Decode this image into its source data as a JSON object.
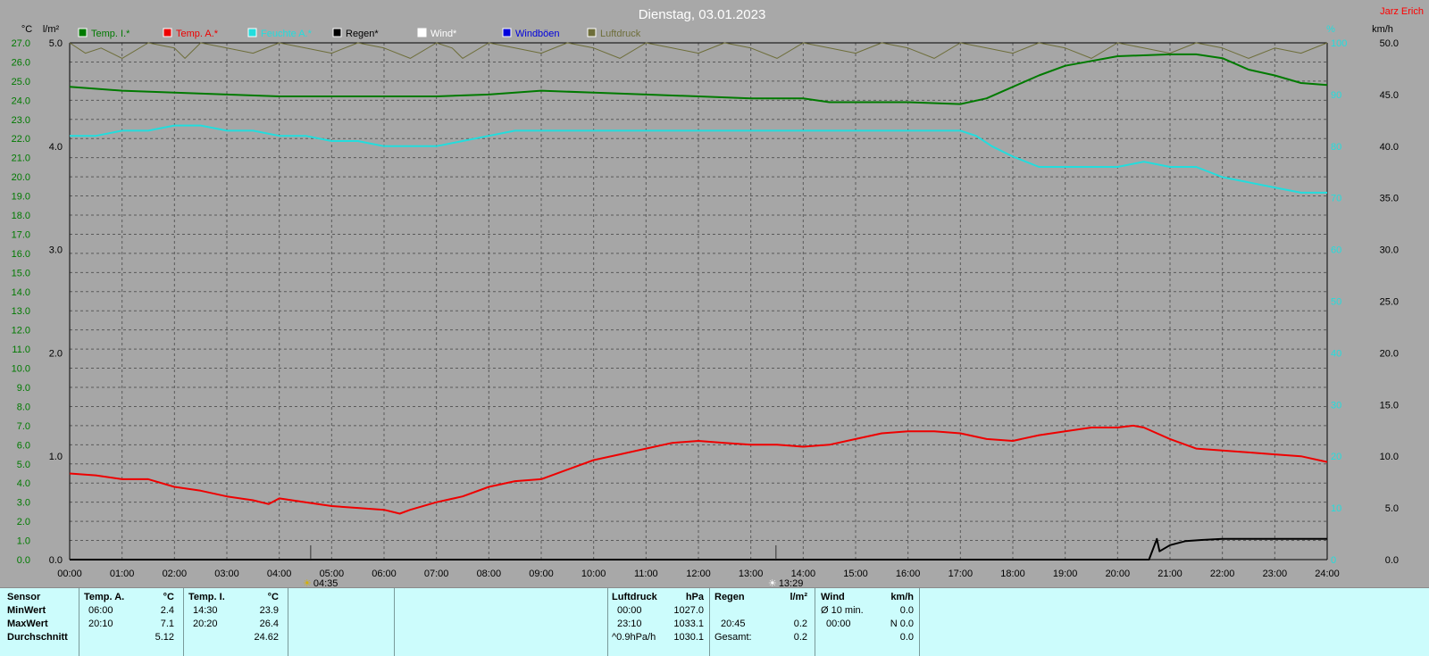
{
  "title": "Dienstag, 03.01.2023",
  "author": "Jarz Erich",
  "axis_units": {
    "temp": "°C",
    "rain": "l/m²",
    "humidity": "%",
    "wind": "km/h"
  },
  "colors": {
    "temp_in": "#007a00",
    "temp_out": "#ee0000",
    "humidity": "#22dddd",
    "rain": "#000000",
    "wind": "#ffffff",
    "gusts": "#0000dd",
    "pressure": "#6e6e3a"
  },
  "legend": [
    {
      "label": "Temp. I.*",
      "color": "#007a00"
    },
    {
      "label": "Temp. A.*",
      "color": "#ee0000"
    },
    {
      "label": "Feuchte A.*",
      "color": "#22dddd"
    },
    {
      "label": "Regen*",
      "color": "#000000"
    },
    {
      "label": "Wind*",
      "color": "#ffffff"
    },
    {
      "label": "Windböen",
      "color": "#0000dd"
    },
    {
      "label": "Luftdruck",
      "color": "#6e6e3a"
    }
  ],
  "sun_events": [
    {
      "label": "04:35",
      "hour": 4.6
    },
    {
      "label": "13:29",
      "hour": 13.48
    }
  ],
  "chart_data": {
    "type": "line",
    "xlim": [
      0,
      24
    ],
    "x_ticks": [
      "00:00",
      "01:00",
      "02:00",
      "03:00",
      "04:00",
      "05:00",
      "06:00",
      "07:00",
      "08:00",
      "09:00",
      "10:00",
      "11:00",
      "12:00",
      "13:00",
      "14:00",
      "15:00",
      "16:00",
      "17:00",
      "18:00",
      "19:00",
      "20:00",
      "21:00",
      "22:00",
      "23:00",
      "24:00"
    ],
    "y_left_temp": {
      "lim": [
        0,
        27
      ],
      "ticks": [
        "0.0",
        "1.0",
        "2.0",
        "3.0",
        "4.0",
        "5.0",
        "6.0",
        "7.0",
        "8.0",
        "9.0",
        "10.0",
        "11.0",
        "12.0",
        "13.0",
        "14.0",
        "15.0",
        "16.0",
        "17.0",
        "18.0",
        "19.0",
        "20.0",
        "21.0",
        "22.0",
        "23.0",
        "24.0",
        "25.0",
        "26.0",
        "27.0"
      ]
    },
    "y_left_rain": {
      "lim": [
        0,
        5
      ],
      "ticks": [
        "0.0",
        "1.0",
        "2.0",
        "3.0",
        "4.0",
        "5.0"
      ]
    },
    "y_right_humidity": {
      "lim": [
        0,
        100
      ],
      "ticks": [
        "0",
        "10",
        "20",
        "30",
        "40",
        "50",
        "60",
        "70",
        "80",
        "90",
        "100"
      ]
    },
    "y_right_wind": {
      "lim": [
        0,
        50
      ],
      "ticks": [
        "0.0",
        "5.0",
        "10.0",
        "15.0",
        "20.0",
        "25.0",
        "30.0",
        "35.0",
        "40.0",
        "45.0",
        "50.0"
      ]
    },
    "series": [
      {
        "name": "Temp. I.*",
        "axis": "temp",
        "color": "#007a00",
        "x": [
          0,
          1,
          2,
          3,
          4,
          5,
          6,
          7,
          8,
          9,
          10,
          11,
          12,
          13,
          14,
          14.5,
          15,
          16,
          17,
          17.5,
          18,
          18.5,
          19,
          20,
          21,
          21.5,
          22,
          22.5,
          23,
          23.5,
          24
        ],
        "y": [
          24.7,
          24.5,
          24.4,
          24.3,
          24.2,
          24.2,
          24.2,
          24.2,
          24.3,
          24.5,
          24.4,
          24.3,
          24.2,
          24.1,
          24.1,
          23.9,
          23.9,
          23.9,
          23.8,
          24.1,
          24.7,
          25.3,
          25.8,
          26.3,
          26.4,
          26.4,
          26.2,
          25.6,
          25.3,
          24.9,
          24.8
        ]
      },
      {
        "name": "Temp. A.*",
        "axis": "temp",
        "color": "#ee0000",
        "x": [
          0,
          0.5,
          1,
          1.5,
          2,
          2.5,
          3,
          3.5,
          3.8,
          4,
          4.5,
          5,
          5.5,
          6,
          6.3,
          6.5,
          7,
          7.5,
          8,
          8.5,
          9,
          9.5,
          10,
          10.5,
          11,
          11.5,
          12,
          12.5,
          13,
          13.5,
          14,
          14.5,
          15,
          15.5,
          16,
          16.5,
          17,
          17.5,
          18,
          18.5,
          19,
          19.5,
          20,
          20.3,
          20.5,
          21,
          21.5,
          22,
          22.5,
          23,
          23.5,
          24
        ],
        "y": [
          4.5,
          4.4,
          4.2,
          4.2,
          3.8,
          3.6,
          3.3,
          3.1,
          2.9,
          3.2,
          3.0,
          2.8,
          2.7,
          2.6,
          2.4,
          2.6,
          3.0,
          3.3,
          3.8,
          4.1,
          4.2,
          4.7,
          5.2,
          5.5,
          5.8,
          6.1,
          6.2,
          6.1,
          6.0,
          6.0,
          5.9,
          6.0,
          6.3,
          6.6,
          6.7,
          6.7,
          6.6,
          6.3,
          6.2,
          6.5,
          6.7,
          6.9,
          6.9,
          7.0,
          6.9,
          6.3,
          5.8,
          5.7,
          5.6,
          5.5,
          5.4,
          5.1
        ]
      },
      {
        "name": "Feuchte A.*",
        "axis": "humidity",
        "color": "#22dddd",
        "x": [
          0,
          0.5,
          1,
          1.5,
          2,
          2.5,
          3,
          3.5,
          4,
          4.5,
          5,
          5.5,
          6,
          6.5,
          7,
          7.5,
          8,
          8.5,
          9,
          10,
          11,
          12,
          13,
          14,
          15,
          16,
          17,
          17.3,
          17.6,
          18,
          18.5,
          19,
          19.5,
          20,
          20.5,
          21,
          21.5,
          22,
          22.5,
          23,
          23.5,
          24
        ],
        "y": [
          82,
          82,
          83,
          83,
          84,
          84,
          83,
          83,
          82,
          82,
          81,
          81,
          80,
          80,
          80,
          81,
          82,
          83,
          83,
          83,
          83,
          83,
          83,
          83,
          83,
          83,
          83,
          82,
          80,
          78,
          76,
          76,
          76,
          76,
          77,
          76,
          76,
          74,
          73,
          72,
          71,
          71
        ]
      },
      {
        "name": "Regen*",
        "axis": "rain",
        "color": "#000000",
        "x": [
          0,
          20.6,
          20.75,
          20.8,
          21,
          21.3,
          21.6,
          22,
          22.5,
          23,
          23.5,
          24
        ],
        "y": [
          0,
          0,
          0.2,
          0.08,
          0.14,
          0.18,
          0.19,
          0.2,
          0.2,
          0.2,
          0.2,
          0.2
        ]
      },
      {
        "name": "Luftdruck",
        "axis": "humidity",
        "color": "#6e6e3a",
        "x": [
          0,
          0.3,
          0.6,
          1,
          1.5,
          2,
          2.2,
          2.5,
          3,
          3.5,
          4,
          4.5,
          5,
          5.5,
          6,
          6.5,
          7,
          7.3,
          7.5,
          8,
          8.5,
          9,
          9.5,
          10,
          10.5,
          11,
          11.5,
          12,
          12.5,
          13,
          13.5,
          14,
          14.5,
          15,
          15.5,
          16,
          16.5,
          17,
          17.5,
          18,
          18.5,
          19,
          19.5,
          20,
          20.5,
          21,
          21.5,
          22,
          22.5,
          23,
          23.5,
          24
        ],
        "y": [
          100,
          98,
          99,
          97,
          100,
          99,
          97,
          100,
          99,
          98,
          100,
          99,
          98,
          100,
          99,
          97,
          100,
          99,
          97,
          100,
          99,
          98,
          100,
          99,
          97,
          100,
          99,
          98,
          100,
          99,
          97,
          100,
          99,
          98,
          100,
          99,
          97,
          100,
          99,
          98,
          100,
          99,
          97,
          100,
          99,
          98,
          100,
          99,
          97,
          99,
          98,
          100
        ]
      }
    ]
  },
  "table": {
    "sensor": {
      "header": "Sensor",
      "rows": [
        "MinWert",
        "MaxWert",
        "Durchschnitt"
      ]
    },
    "temp_a": {
      "header": "Temp. A.",
      "unit": "°C",
      "rows": [
        [
          "06:00",
          "2.4"
        ],
        [
          "20:10",
          "7.1"
        ],
        [
          "",
          "5.12"
        ]
      ]
    },
    "temp_i": {
      "header": "Temp. I.",
      "unit": "°C",
      "rows": [
        [
          "14:30",
          "23.9"
        ],
        [
          "20:20",
          "26.4"
        ],
        [
          "",
          "24.62"
        ]
      ]
    },
    "pressure": {
      "header": "Luftdruck",
      "unit": "hPa",
      "rows": [
        [
          "00:00",
          "1027.0"
        ],
        [
          "23:10",
          "1033.1"
        ],
        [
          "^0.9hPa/h",
          "1030.1"
        ]
      ]
    },
    "rain": {
      "header": "Regen",
      "unit": "l/m²",
      "rows": [
        [
          "",
          ""
        ],
        [
          "20:45",
          "0.2"
        ],
        [
          "Gesamt:",
          "0.2"
        ]
      ]
    },
    "wind": {
      "header": "Wind",
      "unit": "km/h",
      "rows": [
        [
          "Ø 10 min.",
          "0.0"
        ],
        [
          "00:00",
          "N 0.0"
        ],
        [
          "",
          "0.0"
        ]
      ]
    }
  }
}
